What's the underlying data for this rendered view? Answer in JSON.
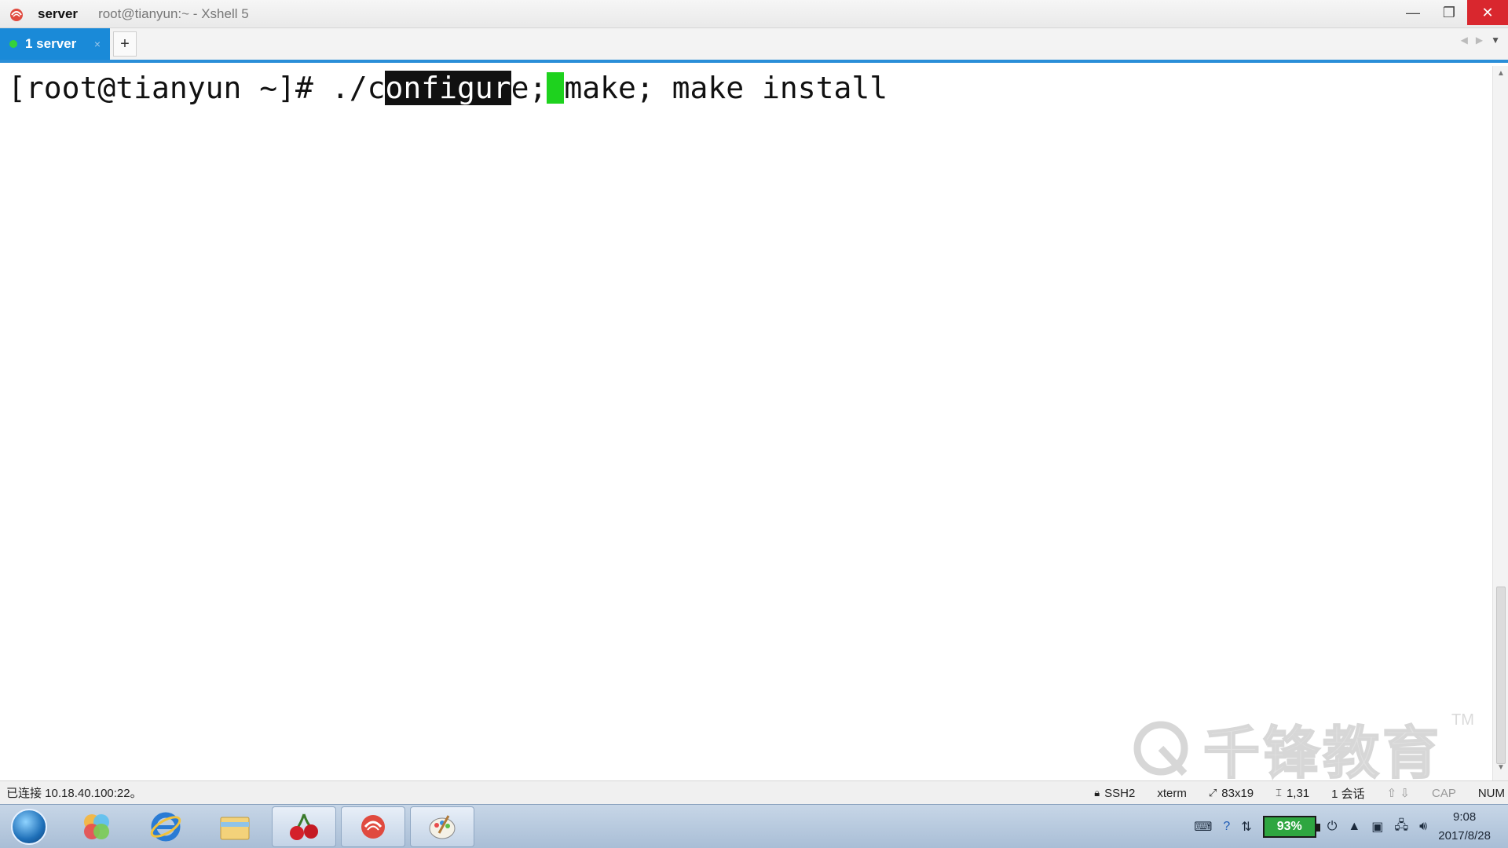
{
  "window": {
    "session_name": "server",
    "title": "root@tianyun:~ - Xshell 5",
    "minimize": "—",
    "restore": "❐",
    "close": "✕"
  },
  "tabs": {
    "items": [
      {
        "label": "1 server",
        "close": "×"
      }
    ],
    "add_label": "+"
  },
  "terminal": {
    "prompt": "[root@tianyun ~]# ",
    "cmd_before_selection": "./c",
    "selected_text": "onfigur",
    "cmd_after_selection": "e;",
    "cmd_after_cursor": "make; make install"
  },
  "watermark": {
    "text": "千锋教育",
    "tm": "TM"
  },
  "statusbar": {
    "connection": "已连接 10.18.40.100:22。",
    "protocol": "SSH2",
    "terminal_type": "xterm",
    "size": "83x19",
    "cursor_pos": "1,31",
    "sessions": "1 会话",
    "cap": "CAP",
    "num": "NUM"
  },
  "taskbar": {
    "battery": "93%",
    "time": "9:08",
    "date": "2017/8/28"
  },
  "colors": {
    "tab_active": "#1a8ad8",
    "cursor": "#1ed21e",
    "close_button": "#d9272e"
  }
}
